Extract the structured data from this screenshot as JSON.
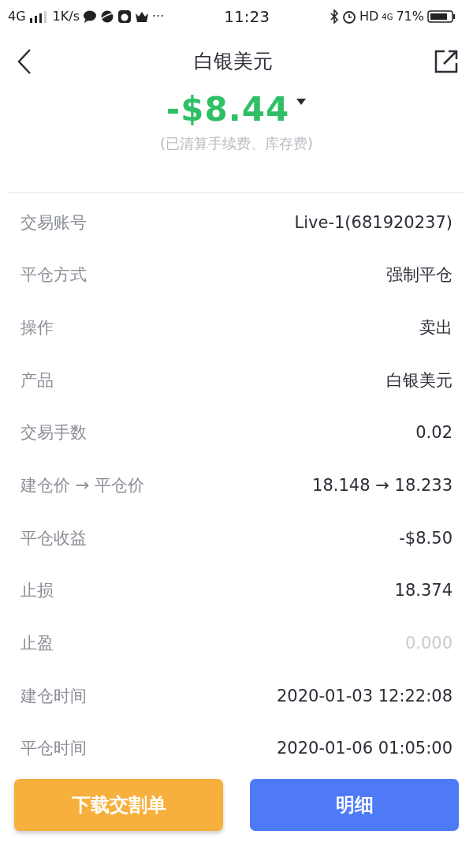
{
  "status_bar": {
    "network": "4G",
    "speed": "1K/s",
    "more": "···",
    "time": "11:23",
    "hd": "HD",
    "data_network": "4G",
    "battery": "71%"
  },
  "header": {
    "title": "白银美元"
  },
  "summary": {
    "amount": "-$8.44",
    "note": "(已清算手续费、库存费)"
  },
  "rows": [
    {
      "label": "交易账号",
      "value": "Live-1(681920237)",
      "dimmed": false
    },
    {
      "label": "平仓方式",
      "value": "强制平仓",
      "dimmed": false
    },
    {
      "label": "操作",
      "value": "卖出",
      "dimmed": false
    },
    {
      "label": "产品",
      "value": "白银美元",
      "dimmed": false
    },
    {
      "label": "交易手数",
      "value": "0.02",
      "dimmed": false
    },
    {
      "label": "建仓价 → 平仓价",
      "value": "18.148 → 18.233",
      "dimmed": false
    },
    {
      "label": "平仓收益",
      "value": "-$8.50",
      "dimmed": false
    },
    {
      "label": "止损",
      "value": "18.374",
      "dimmed": false
    },
    {
      "label": "止盈",
      "value": "0.000",
      "dimmed": true
    },
    {
      "label": "建仓时间",
      "value": "2020-01-03 12:22:08",
      "dimmed": false
    },
    {
      "label": "平仓时间",
      "value": "2020-01-06 01:05:00",
      "dimmed": false
    }
  ],
  "buttons": [
    {
      "label": "下载交割单",
      "kind": "secondary"
    },
    {
      "label": "明细",
      "kind": "primary"
    }
  ]
}
